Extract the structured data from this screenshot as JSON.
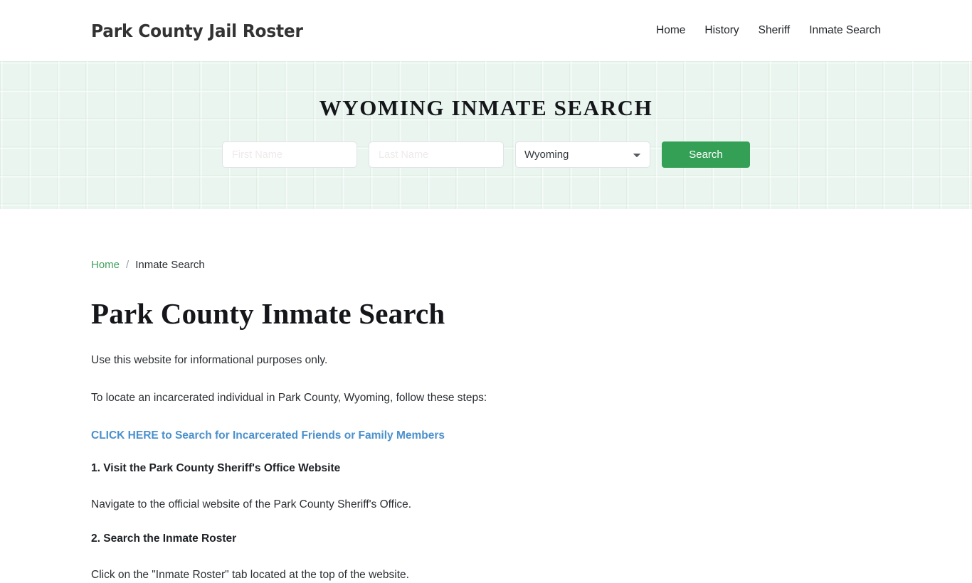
{
  "header": {
    "brand": "Park County Jail Roster",
    "nav": [
      {
        "label": "Home"
      },
      {
        "label": "History"
      },
      {
        "label": "Sheriff"
      },
      {
        "label": "Inmate Search"
      }
    ]
  },
  "hero": {
    "title": "WYOMING INMATE SEARCH",
    "form": {
      "first_name_placeholder": "First Name",
      "first_name_value": "",
      "last_name_placeholder": "Last Name",
      "last_name_value": "",
      "state_selected": "Wyoming",
      "state_options": [
        "Wyoming"
      ],
      "search_label": "Search"
    },
    "colors": {
      "background": "#eaf5ef",
      "button": "#33a055"
    }
  },
  "breadcrumb": {
    "home_label": "Home",
    "separator": "/",
    "current_label": "Inmate Search"
  },
  "main": {
    "title": "Park County Inmate Search",
    "intro": "Use this website for informational purposes only.",
    "instruction": "To locate an incarcerated individual in Park County, Wyoming, follow these steps:",
    "cta": "CLICK HERE to Search for Incarcerated Friends or Family Members",
    "steps": [
      {
        "heading": "1. Visit the Park County Sheriff's Office Website",
        "body": "Navigate to the official website of the Park County Sheriff's Office."
      },
      {
        "heading": "2. Search the Inmate Roster",
        "body": "Click on the \"Inmate Roster\" tab located at the top of the website."
      }
    ]
  }
}
